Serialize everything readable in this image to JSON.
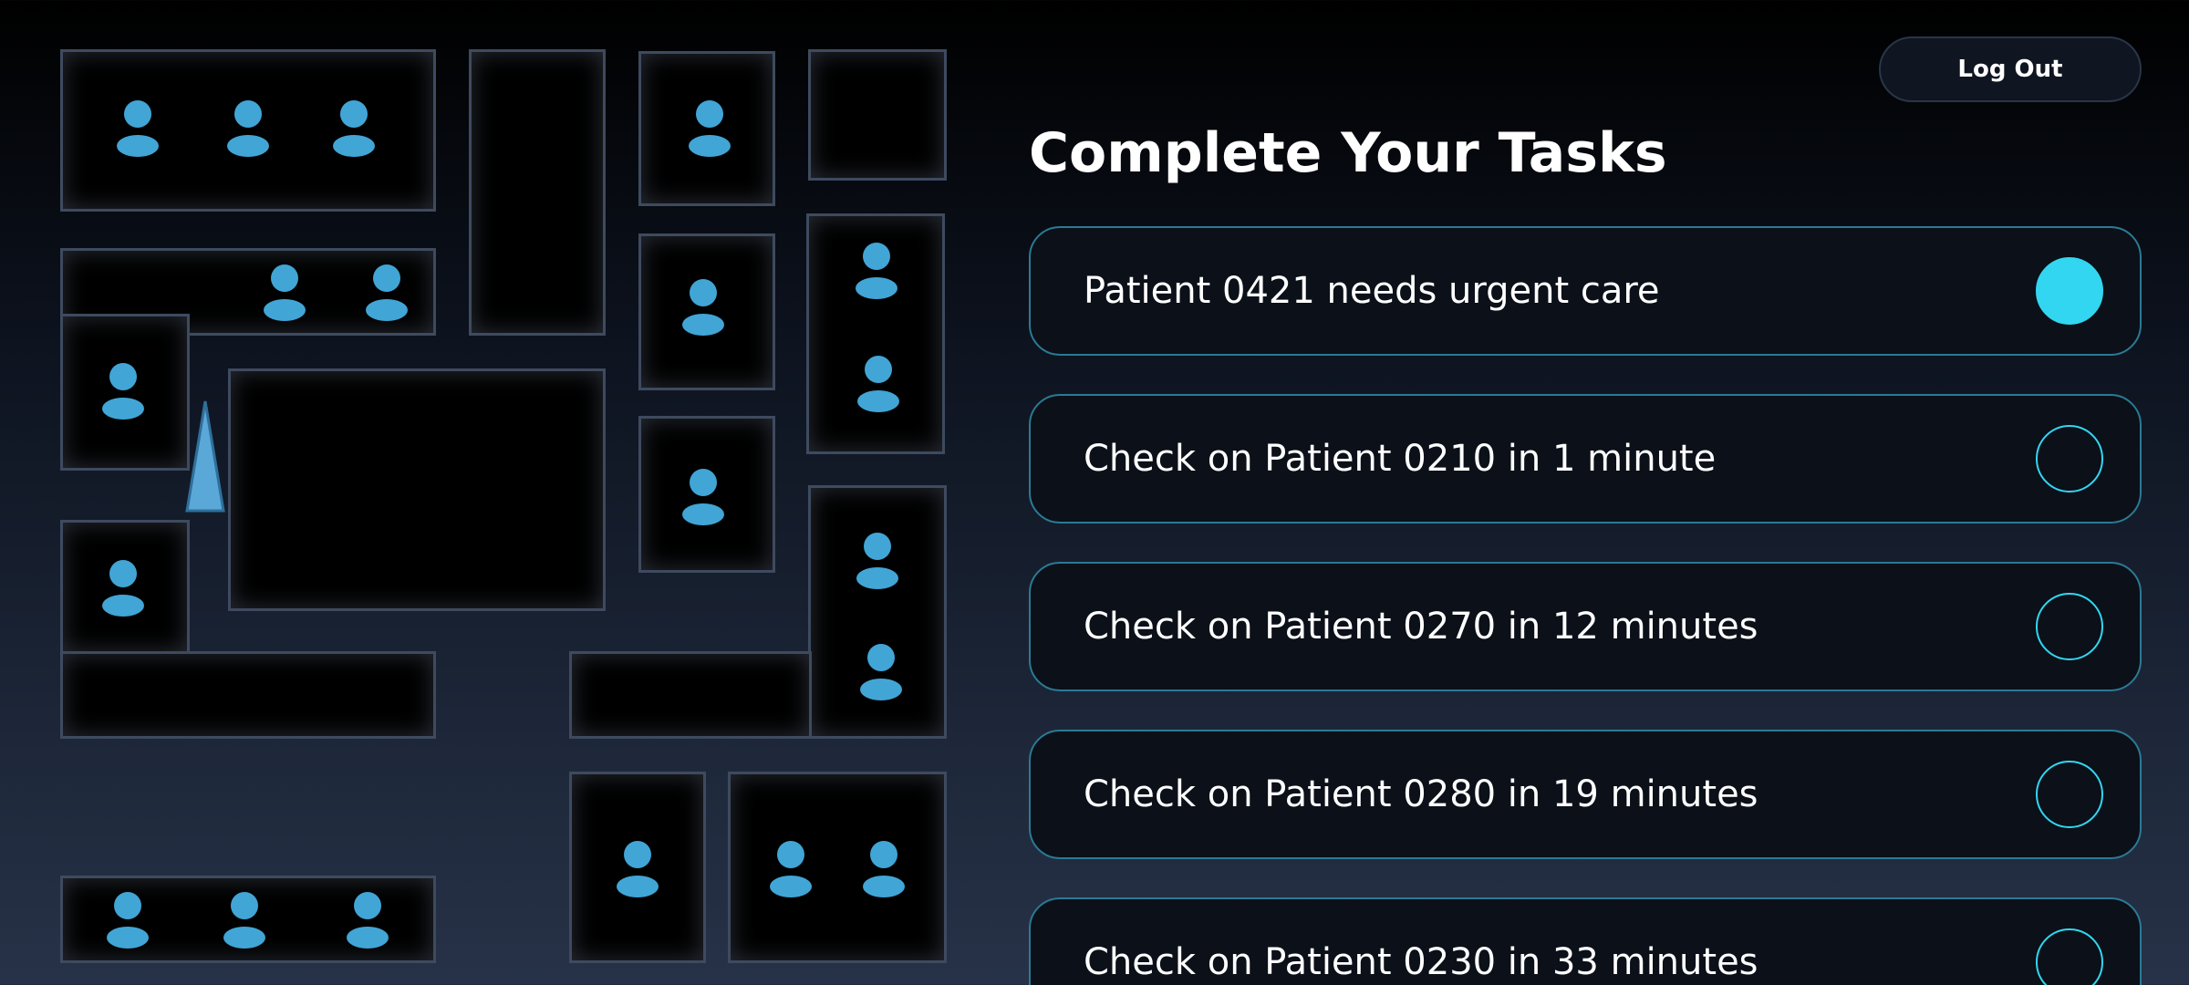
{
  "header": {
    "logout_label": "Log Out",
    "title": "Complete Your Tasks"
  },
  "tasks": [
    {
      "label": "Patient 0421 needs urgent care",
      "completed": true
    },
    {
      "label": "Check on Patient 0210 in 1 minute",
      "completed": false
    },
    {
      "label": "Check on Patient 0270 in 12 minutes",
      "completed": false
    },
    {
      "label": "Check on Patient 0280 in 19 minutes",
      "completed": false
    },
    {
      "label": "Check on Patient 0230 in 33 minutes",
      "completed": false
    }
  ],
  "map": {
    "patient_icon": "person-icon",
    "player_icon": "player-cone-icon"
  },
  "colors": {
    "accent": "#33d6f0",
    "patient": "#41a5d6",
    "room_border": "#3e4a5f",
    "task_border": "#2b7a94"
  }
}
